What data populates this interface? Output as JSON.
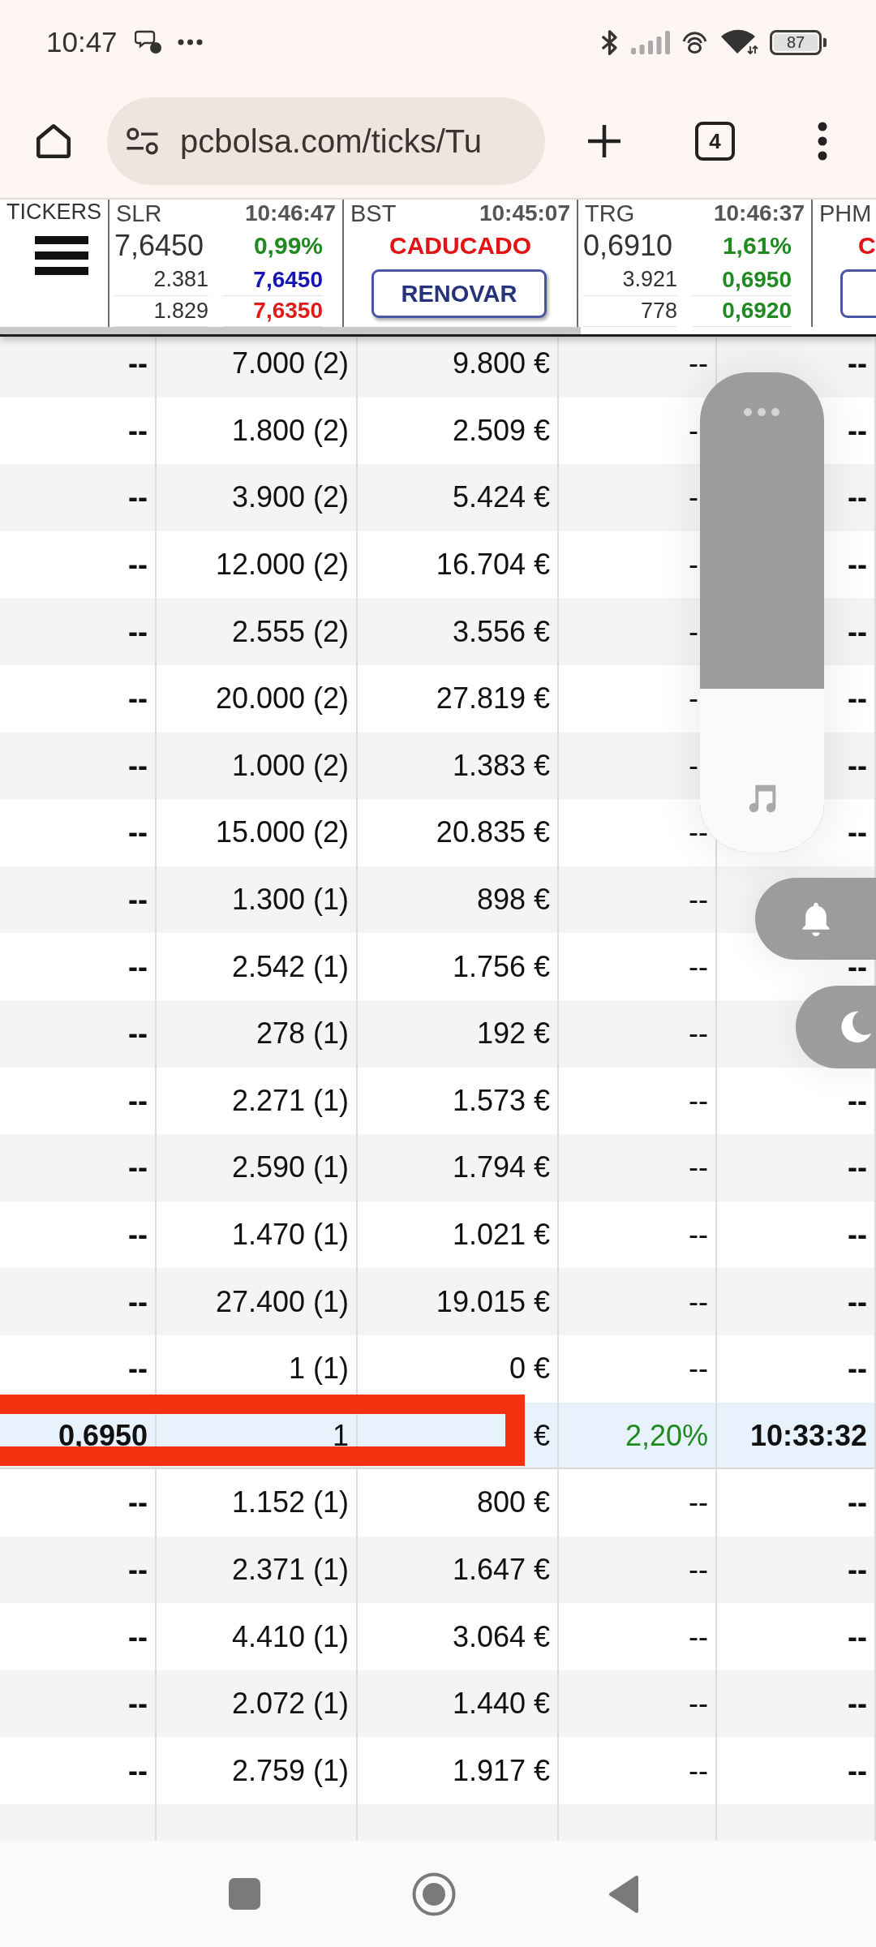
{
  "status_bar": {
    "time": "10:47",
    "battery": "87"
  },
  "browser": {
    "url": "pcbolsa.com/ticks/Tu",
    "tab_count": "4"
  },
  "tickers": {
    "label": "TICKERS",
    "items": [
      {
        "kind": "quote",
        "symbol": "SLR",
        "time": "10:46:47",
        "price": "7,6450",
        "change": {
          "text": "0,99%",
          "color": "#1f8a1f"
        },
        "depth": [
          {
            "size": "2.381",
            "price": "7,6450",
            "color": "#1515b5"
          },
          {
            "size": "1.829",
            "price": "7,6350",
            "color": "#e01b1b"
          }
        ]
      },
      {
        "kind": "expired",
        "symbol": "BST",
        "time": "10:45:07",
        "status": "CADUCADO",
        "button": "RENOVAR"
      },
      {
        "kind": "quote",
        "symbol": "TRG",
        "time": "10:46:37",
        "price": "0,6910",
        "change": {
          "text": "1,61%",
          "color": "#1f8a1f"
        },
        "depth": [
          {
            "size": "3.921",
            "price": "0,6950",
            "color": "#1f8a1f"
          },
          {
            "size": "778",
            "price": "0,6920",
            "color": "#1f8a1f"
          }
        ]
      },
      {
        "kind": "expired",
        "symbol": "PHM",
        "status": "C"
      }
    ]
  },
  "table": {
    "rows": [
      {
        "column_1": "--",
        "column_2": "7.000 (2)",
        "column_3": "9.800 €",
        "column_4": "--",
        "column_5": "--",
        "highlighted": false,
        "annotated": false
      },
      {
        "column_1": "--",
        "column_2": "1.800 (2)",
        "column_3": "2.509 €",
        "column_4": "-",
        "column_5": "--",
        "highlighted": false,
        "annotated": false
      },
      {
        "column_1": "--",
        "column_2": "3.900 (2)",
        "column_3": "5.424 €",
        "column_4": "-",
        "column_5": "--",
        "highlighted": false,
        "annotated": false
      },
      {
        "column_1": "--",
        "column_2": "12.000 (2)",
        "column_3": "16.704 €",
        "column_4": "-",
        "column_5": "--",
        "highlighted": false,
        "annotated": false
      },
      {
        "column_1": "--",
        "column_2": "2.555 (2)",
        "column_3": "3.556 €",
        "column_4": "-",
        "column_5": "--",
        "highlighted": false,
        "annotated": false
      },
      {
        "column_1": "--",
        "column_2": "20.000 (2)",
        "column_3": "27.819 €",
        "column_4": "-",
        "column_5": "--",
        "highlighted": false,
        "annotated": false
      },
      {
        "column_1": "--",
        "column_2": "1.000 (2)",
        "column_3": "1.383 €",
        "column_4": "-",
        "column_5": "--",
        "highlighted": false,
        "annotated": false
      },
      {
        "column_1": "--",
        "column_2": "15.000 (2)",
        "column_3": "20.835 €",
        "column_4": "--",
        "column_5": "--",
        "highlighted": false,
        "annotated": false
      },
      {
        "column_1": "--",
        "column_2": "1.300 (1)",
        "column_3": "898 €",
        "column_4": "--",
        "highlighted": false,
        "annotated": false
      },
      {
        "column_1": "--",
        "column_2": "2.542 (1)",
        "column_3": "1.756 €",
        "column_4": "--",
        "column_5": "--",
        "highlighted": false,
        "annotated": false
      },
      {
        "column_1": "--",
        "column_2": "278 (1)",
        "column_3": "192 €",
        "column_4": "--",
        "highlighted": false,
        "annotated": false
      },
      {
        "column_1": "--",
        "column_2": "2.271 (1)",
        "column_3": "1.573 €",
        "column_4": "--",
        "column_5": "--",
        "highlighted": false,
        "annotated": false
      },
      {
        "column_1": "--",
        "column_2": "2.590 (1)",
        "column_3": "1.794 €",
        "column_4": "--",
        "column_5": "--",
        "highlighted": false,
        "annotated": false
      },
      {
        "column_1": "--",
        "column_2": "1.470 (1)",
        "column_3": "1.021 €",
        "column_4": "--",
        "column_5": "--",
        "highlighted": false,
        "annotated": false
      },
      {
        "column_1": "--",
        "column_2": "27.400 (1)",
        "column_3": "19.015 €",
        "column_4": "--",
        "column_5": "--",
        "highlighted": false,
        "annotated": false
      },
      {
        "column_1": "--",
        "column_2": "1 (1)",
        "column_3": "0 €",
        "column_4": "--",
        "column_5": "--",
        "highlighted": false,
        "annotated": false
      },
      {
        "column_1": "0,6950",
        "column_2": "1",
        "column_3": "€",
        "column_4": "2,20%",
        "column_5": "10:33:32",
        "color": "#1f8a1f",
        "highlighted": true,
        "annotated": true
      },
      {
        "column_1": "--",
        "column_2": "1.152 (1)",
        "column_3": "800 €",
        "column_4": "--",
        "column_5": "--",
        "highlighted": false,
        "annotated": false
      },
      {
        "column_1": "--",
        "column_2": "2.371 (1)",
        "column_3": "1.647 €",
        "column_4": "--",
        "column_5": "--",
        "highlighted": false,
        "annotated": false
      },
      {
        "column_1": "--",
        "column_2": "4.410 (1)",
        "column_3": "3.064 €",
        "column_4": "--",
        "column_5": "--",
        "highlighted": false,
        "annotated": false
      },
      {
        "column_1": "--",
        "column_2": "2.072 (1)",
        "column_3": "1.440 €",
        "column_4": "--",
        "column_5": "--",
        "highlighted": false,
        "annotated": false
      },
      {
        "column_1": "--",
        "column_2": "2.759 (1)",
        "column_3": "1.917 €",
        "column_4": "--",
        "column_5": "--",
        "highlighted": false,
        "annotated": false
      },
      {
        "highlighted": false,
        "annotated": false
      }
    ]
  },
  "volume_panel": {
    "level": 0.34
  }
}
